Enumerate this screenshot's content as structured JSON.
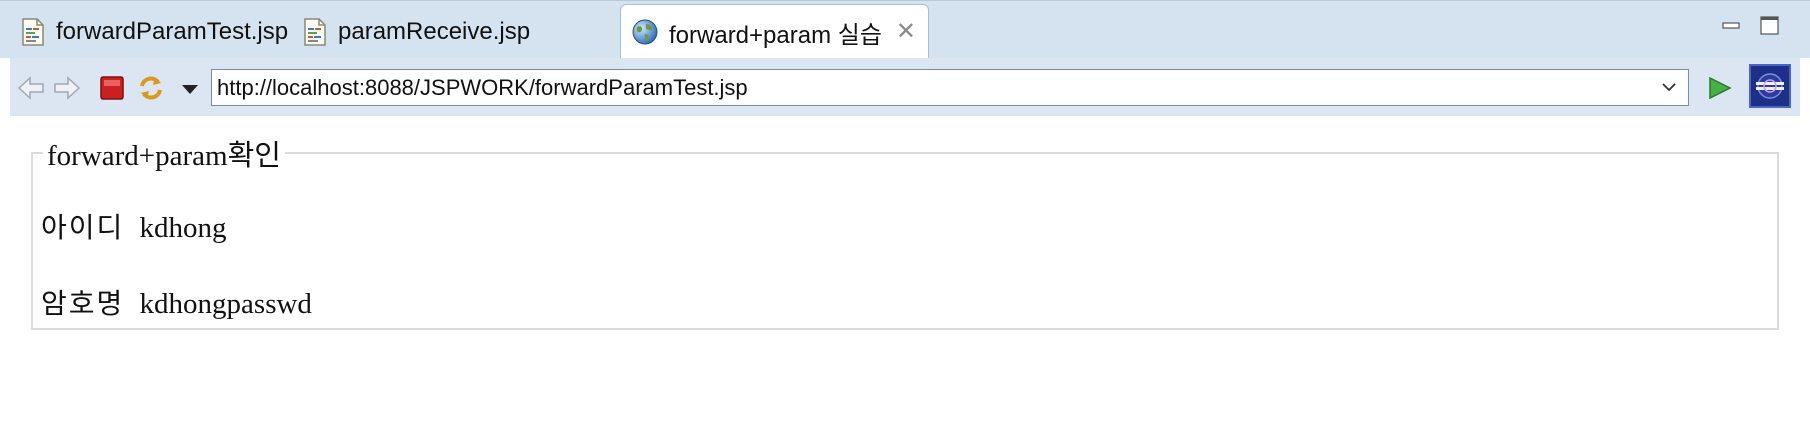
{
  "tabs": [
    {
      "label": "forwardParamTest.jsp",
      "icon": "jsp-file-icon",
      "active": false
    },
    {
      "label": "paramReceive.jsp",
      "icon": "jsp-file-icon",
      "active": false
    },
    {
      "label": "forward+param 실습",
      "icon": "globe-icon",
      "active": true
    }
  ],
  "window_controls": {
    "minimize_icon": "minimize-icon",
    "maximize_icon": "maximize-icon"
  },
  "toolbar": {
    "back_icon": "back-arrow-icon",
    "forward_icon": "forward-arrow-icon",
    "stop_icon": "stop-icon",
    "refresh_icon": "refresh-icon",
    "menu_icon": "dropdown-menu-icon",
    "url": "http://localhost:8088/JSPWORK/forwardParamTest.jsp",
    "go_icon": "go-play-icon",
    "eclipse_icon": "eclipse-icon"
  },
  "form": {
    "legend": "forward+param확인",
    "fields": [
      {
        "label": "아이디",
        "value": "kdhong"
      },
      {
        "label": "암호명",
        "value": "kdhongpasswd"
      }
    ]
  },
  "colors": {
    "tabbar_bg": "#d5e2ef",
    "toolbar_bg": "#dbe6f2",
    "stop_red": "#cc2020",
    "go_green": "#3aa03a"
  }
}
